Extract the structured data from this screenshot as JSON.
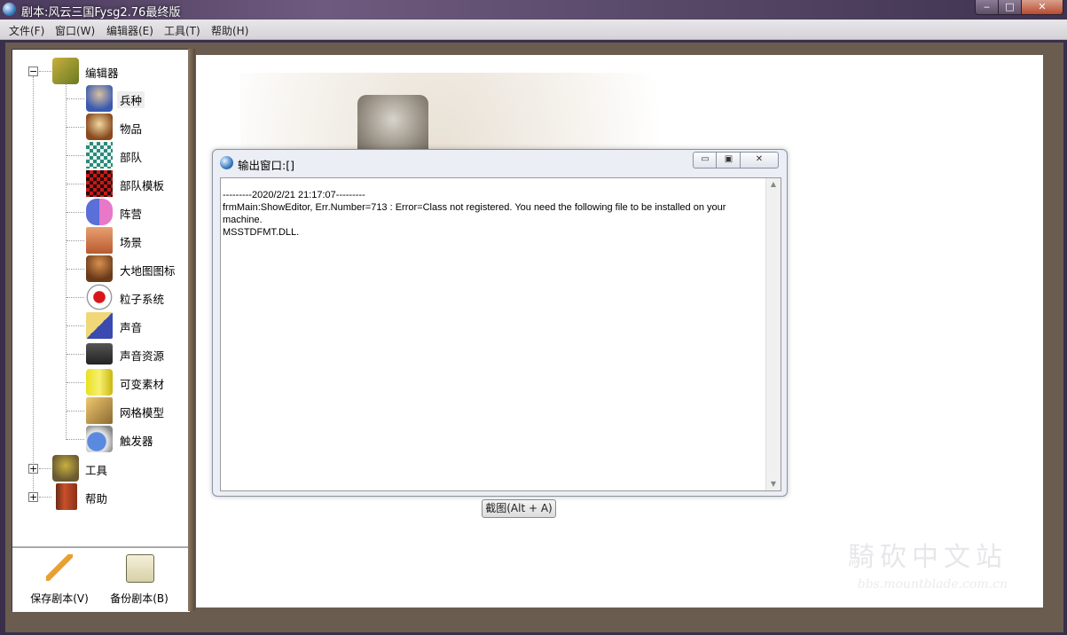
{
  "window": {
    "title": "剧本:风云三国Fysg2.76最终版",
    "min_symbol": "‒",
    "max_symbol": "□",
    "close_symbol": "✕"
  },
  "menubar": {
    "items": [
      "文件(F)",
      "窗口(W)",
      "编辑器(E)",
      "工具(T)",
      "帮助(H)"
    ]
  },
  "tree": {
    "root_editor": "编辑器",
    "editor_children": [
      "兵种",
      "物品",
      "部队",
      "部队模板",
      "阵营",
      "场景",
      "大地图图标",
      "粒子系统",
      "声音",
      "声音资源",
      "可变素材",
      "网格模型",
      "触发器"
    ],
    "root_tools": "工具",
    "root_help": "帮助",
    "collapse_symbol": "−",
    "expand_symbol": "+"
  },
  "bottom_buttons": {
    "save": "保存剧本(V)",
    "backup": "备份剧本(B)"
  },
  "dialog": {
    "title": "输出窗口:[]",
    "log": "---------2020/2/21 21:17:07---------\nfrmMain:ShowEditor, Err.Number=713 : Error=Class not registered. You need the following file to be installed on your machine.\nMSSTDFMT.DLL.",
    "min_symbol": "▭",
    "max_symbol": "▣",
    "close_symbol": "✕",
    "scroll_up": "▲",
    "scroll_down": "▼"
  },
  "screenshot_button": "截图(Alt + A)",
  "watermark": {
    "text": "騎砍中文站",
    "url": "bbs.mountblade.com.cn"
  },
  "colors": {
    "title_bar": "#5a4a6a",
    "menu_bg": "#e2e0e4",
    "frame": "#6a5d50",
    "dialog_bg": "#ebeef4",
    "close_button": "#c0553c"
  }
}
